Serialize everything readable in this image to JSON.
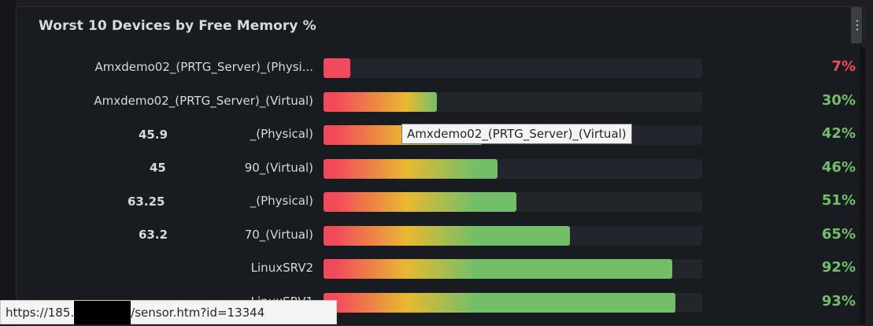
{
  "panel": {
    "title": "Worst 10 Devices by Free Memory %",
    "menu_icon": "vertical-dots-icon",
    "menu_glyph": "⋮"
  },
  "rows": [
    {
      "label": "Amxdemo02_(PRTG_Server)_(Physi...",
      "percent": 7,
      "percent_text": "7%",
      "color": "#f2495c"
    },
    {
      "label": "Amxdemo02_(PRTG_Server)_(Virtual)",
      "percent": 30,
      "percent_text": "30%",
      "color": "#73bf69"
    },
    {
      "label": "_(Physical)",
      "percent": 42,
      "percent_text": "42%",
      "color": "#73bf69"
    },
    {
      "label": "90_(Virtual)",
      "percent": 46,
      "percent_text": "46%",
      "color": "#73bf69"
    },
    {
      "label": "_(Physical)",
      "percent": 51,
      "percent_text": "51%",
      "color": "#73bf69"
    },
    {
      "label": "70_(Virtual)",
      "percent": 65,
      "percent_text": "65%",
      "color": "#73bf69"
    },
    {
      "label": "LinuxSRV2",
      "percent": 92,
      "percent_text": "92%",
      "color": "#73bf69"
    },
    {
      "label": "LinuxSRV1",
      "percent": 93,
      "percent_text": "93%",
      "color": "#73bf69"
    }
  ],
  "hover_values": [
    "45.9",
    "45",
    "63.25",
    "63.2"
  ],
  "tooltip": {
    "text": "Amxdemo02_(PRTG_Server)_(Virtual)"
  },
  "statusbar": {
    "url_prefix": "https://185.",
    "url_suffix": "/sensor.htm?id=13344"
  }
}
